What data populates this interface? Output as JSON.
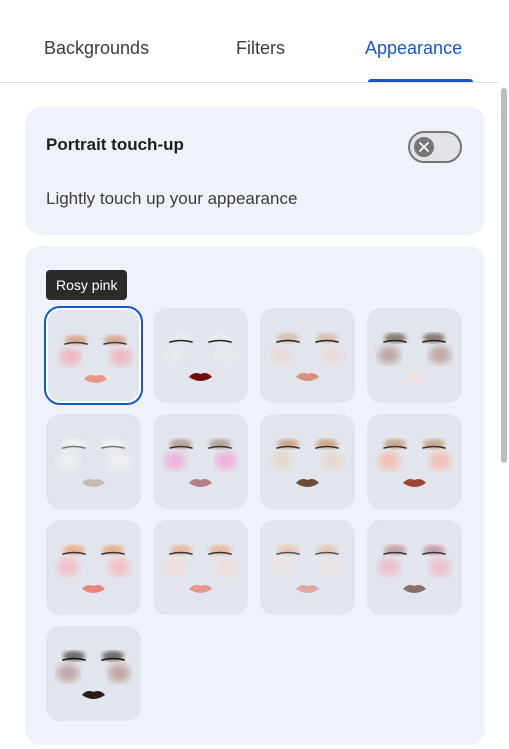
{
  "tabs": [
    {
      "label": "Backgrounds",
      "active": false
    },
    {
      "label": "Filters",
      "active": false
    },
    {
      "label": "Appearance",
      "active": true
    }
  ],
  "touchup": {
    "title": "Portrait touch-up",
    "description": "Lightly touch up your appearance",
    "toggle_on": false,
    "toggle_icon": "close-icon"
  },
  "looks": {
    "tooltip": "Rosy pink",
    "selected_index": 0,
    "tiles": [
      {
        "shadow": "#d9a88f",
        "blush": "#f0b0b8",
        "lip": "#e99888",
        "liner": "#3a3a3a"
      },
      {
        "shadow": "#e9e9ef",
        "blush": "#e9e9ef",
        "lip": "#6e0d0d",
        "liner": "#222222"
      },
      {
        "shadow": "#d8c0b0",
        "blush": "#ecd8d4",
        "lip": "#d98f7c",
        "liner": "#222222"
      },
      {
        "shadow": "#8a7a72",
        "blush": "#b89b95",
        "lip": "#efe2dd",
        "liner": "#222222"
      },
      {
        "shadow": "#f0f0f2",
        "blush": "#f0f0f2",
        "lip": "#c8b8b2",
        "liner": "#777777"
      },
      {
        "shadow": "#b7a39a",
        "blush": "#f0a8d8",
        "lip": "#b37e86",
        "liner": "#333333"
      },
      {
        "shadow": "#cfa888",
        "blush": "#e6d7c9",
        "lip": "#6b4c38",
        "liner": "#333333"
      },
      {
        "shadow": "#c9a88c",
        "blush": "#f4b8a6",
        "lip": "#9b4736",
        "liner": "#333333"
      },
      {
        "shadow": "#eab090",
        "blush": "#f6b8be",
        "lip": "#e9857e",
        "liner": "#333333"
      },
      {
        "shadow": "#e9b8a0",
        "blush": "#f2dcd7",
        "lip": "#e7958a",
        "liner": "#333333"
      },
      {
        "shadow": "#e8c7b6",
        "blush": "#eee3e0",
        "lip": "#dcaaa0",
        "liner": "#555555"
      },
      {
        "shadow": "#c8a0a8",
        "blush": "#eeb7c9",
        "lip": "#8b6d6a",
        "liner": "#333333"
      },
      {
        "shadow": "#6f6863",
        "blush": "#b99a95",
        "lip": "#2a1b16",
        "liner": "#111111"
      }
    ]
  }
}
